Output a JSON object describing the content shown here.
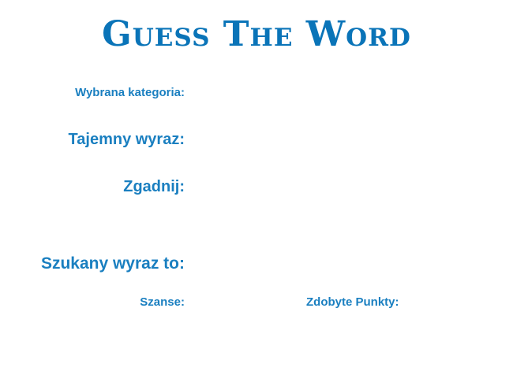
{
  "header": {
    "title": "Guess The Word"
  },
  "game": {
    "category_label": "Wybrana kategoria:",
    "category_value": "",
    "secret_label": "Tajemny wyraz:",
    "secret_value": "",
    "guess_label": "Zgadnij:",
    "guess_value": "",
    "answer_label": "Szukany wyraz to:",
    "answer_value": "",
    "chances_label": "Szanse:",
    "chances_value": "",
    "points_label": "Zdobyte Punkty:",
    "points_value": ""
  },
  "colors": {
    "accent": "#0a74b8",
    "text": "#1a7fc0",
    "background": "#ffffff"
  }
}
